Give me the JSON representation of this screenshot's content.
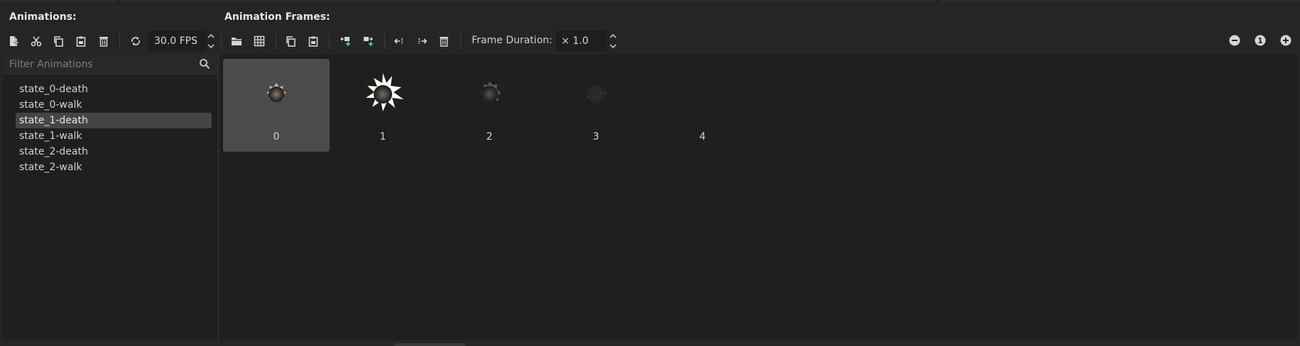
{
  "animations_panel": {
    "title": "Animations:",
    "toolbar": {
      "icons": [
        "new-animation-icon",
        "cut-icon",
        "copy-icon",
        "paste-icon",
        "delete-icon",
        "loop-icon"
      ],
      "fps_value": "30.0 FPS"
    },
    "filter_placeholder": "Filter Animations",
    "items": [
      {
        "label": "state_0-death"
      },
      {
        "label": "state_0-walk"
      },
      {
        "label": "state_1-death",
        "selected": true
      },
      {
        "label": "state_1-walk"
      },
      {
        "label": "state_2-death"
      },
      {
        "label": "state_2-walk"
      }
    ]
  },
  "frames_panel": {
    "title": "Animation Frames:",
    "toolbar": {
      "icons": [
        "load-folder-icon",
        "sprite-grid-icon",
        "copy-icon",
        "paste-icon",
        "insert-before-icon",
        "insert-after-icon",
        "move-left-icon",
        "move-right-icon",
        "delete-icon"
      ],
      "frame_duration_label": "Frame Duration:",
      "frame_duration_value": "× 1.0"
    },
    "zoom": {
      "icons": [
        "zoom-out-icon",
        "zoom-reset-icon",
        "zoom-in-icon"
      ],
      "reset_label": "1"
    },
    "frames": [
      {
        "label": "0",
        "selected": true
      },
      {
        "label": "1"
      },
      {
        "label": "2"
      },
      {
        "label": "3"
      },
      {
        "label": "4"
      }
    ]
  },
  "colors": {
    "accent_green": "#5bbf6a",
    "selected_bg": "#4b4b4b",
    "panel_bg": "#1f1f1f"
  }
}
